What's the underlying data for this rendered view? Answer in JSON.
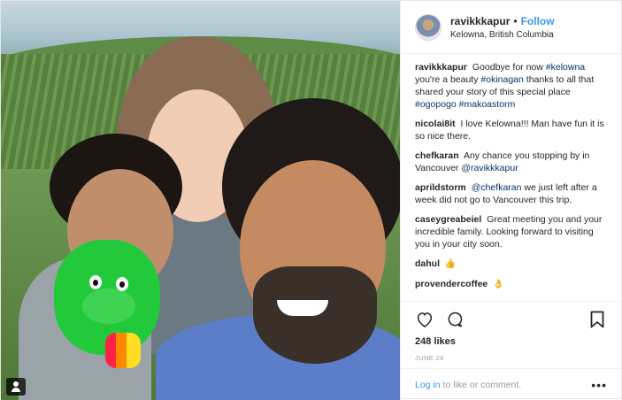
{
  "header": {
    "username": "ravikkkapur",
    "dot": "•",
    "follow_label": "Follow",
    "location": "Kelowna, British Columbia"
  },
  "caption": {
    "username": "ravikkkapur",
    "text_1": "Goodbye for now",
    "tag_kelowna": "#kelowna",
    "text_2": "you're a beauty",
    "tag_okinagan": "#okinagan",
    "text_3": "thanks to all that shared your story of this special place",
    "tag_ogopogo": "#ogopogo",
    "tag_makoastorm": "#makoastorm"
  },
  "comments": [
    {
      "username": "nicolai8it",
      "text": "I love Kelowna!!! Man have fun it is so nice there."
    },
    {
      "username": "chefkaran",
      "text": "Any chance you stopping by in Vancouver",
      "mention": "@ravikkkapur"
    },
    {
      "username": "aprildstorm",
      "mention": "@chefkaran",
      "text": "we just left after a week did not go to Vancouver this trip."
    },
    {
      "username": "caseygreabeiel",
      "text": "Great meeting you and your incredible family. Looking forward to visiting you in your city soon."
    },
    {
      "username": "dahul",
      "emoji": "👍"
    },
    {
      "username": "provendercoffee",
      "emoji": "👌"
    }
  ],
  "actions": {
    "heart_icon": "heart-icon",
    "comment_icon": "comment-icon",
    "bookmark_icon": "bookmark-icon"
  },
  "likes": "248 likes",
  "date": "JUNE 26",
  "footer": {
    "login_link": "Log in",
    "login_text": " to like or comment.",
    "more": "•••"
  },
  "colors": {
    "link_blue": "#3897f0",
    "mention_navy": "#003569",
    "muted_gray": "#999999",
    "text": "#262626"
  }
}
